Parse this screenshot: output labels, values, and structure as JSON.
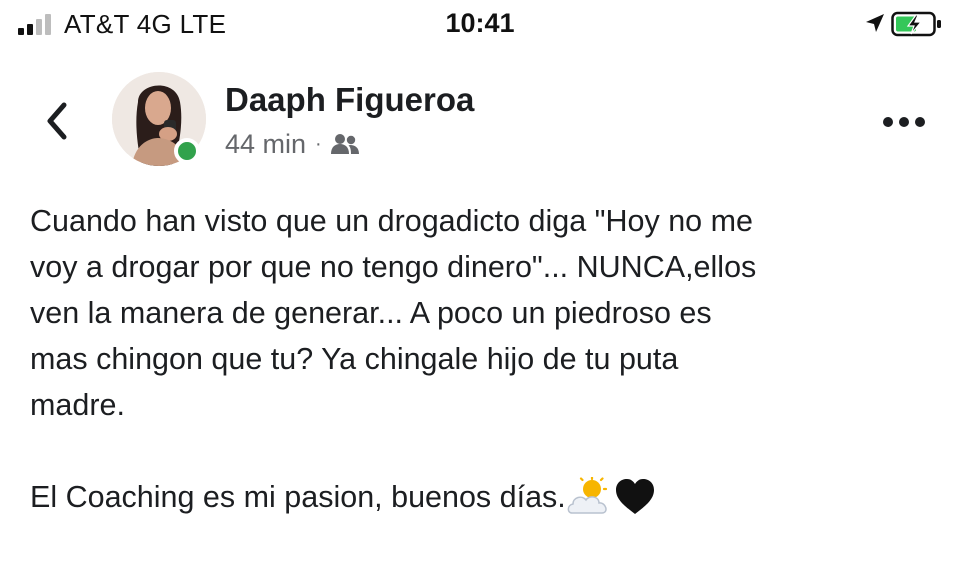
{
  "status_bar": {
    "carrier": "AT&T 4G  LTE",
    "time": "10:41",
    "battery_state": "charging",
    "icons": [
      "signal-icon",
      "location-arrow-icon",
      "battery-charging-icon"
    ]
  },
  "post": {
    "author": "Daaph Figueroa",
    "time_ago": "44 min",
    "separator": "·",
    "audience_icon": "friends-icon",
    "online": true,
    "paragraphs": [
      "Cuando han visto que un drogadicto diga \"Hoy no me\nvoy a drogar por que no tengo dinero\"... NUNCA,ellos\nven la manera de generar... A poco un piedroso es\nmas chingon que tu? Ya chingale hijo de tu puta\nmadre.",
      "El Coaching es mi pasion, buenos días."
    ],
    "emojis": [
      "sun-behind-cloud-emoji",
      "black-heart-emoji"
    ]
  },
  "colors": {
    "online_green": "#31a24c",
    "meta_gray": "#65676b",
    "text": "#1c1e21"
  }
}
